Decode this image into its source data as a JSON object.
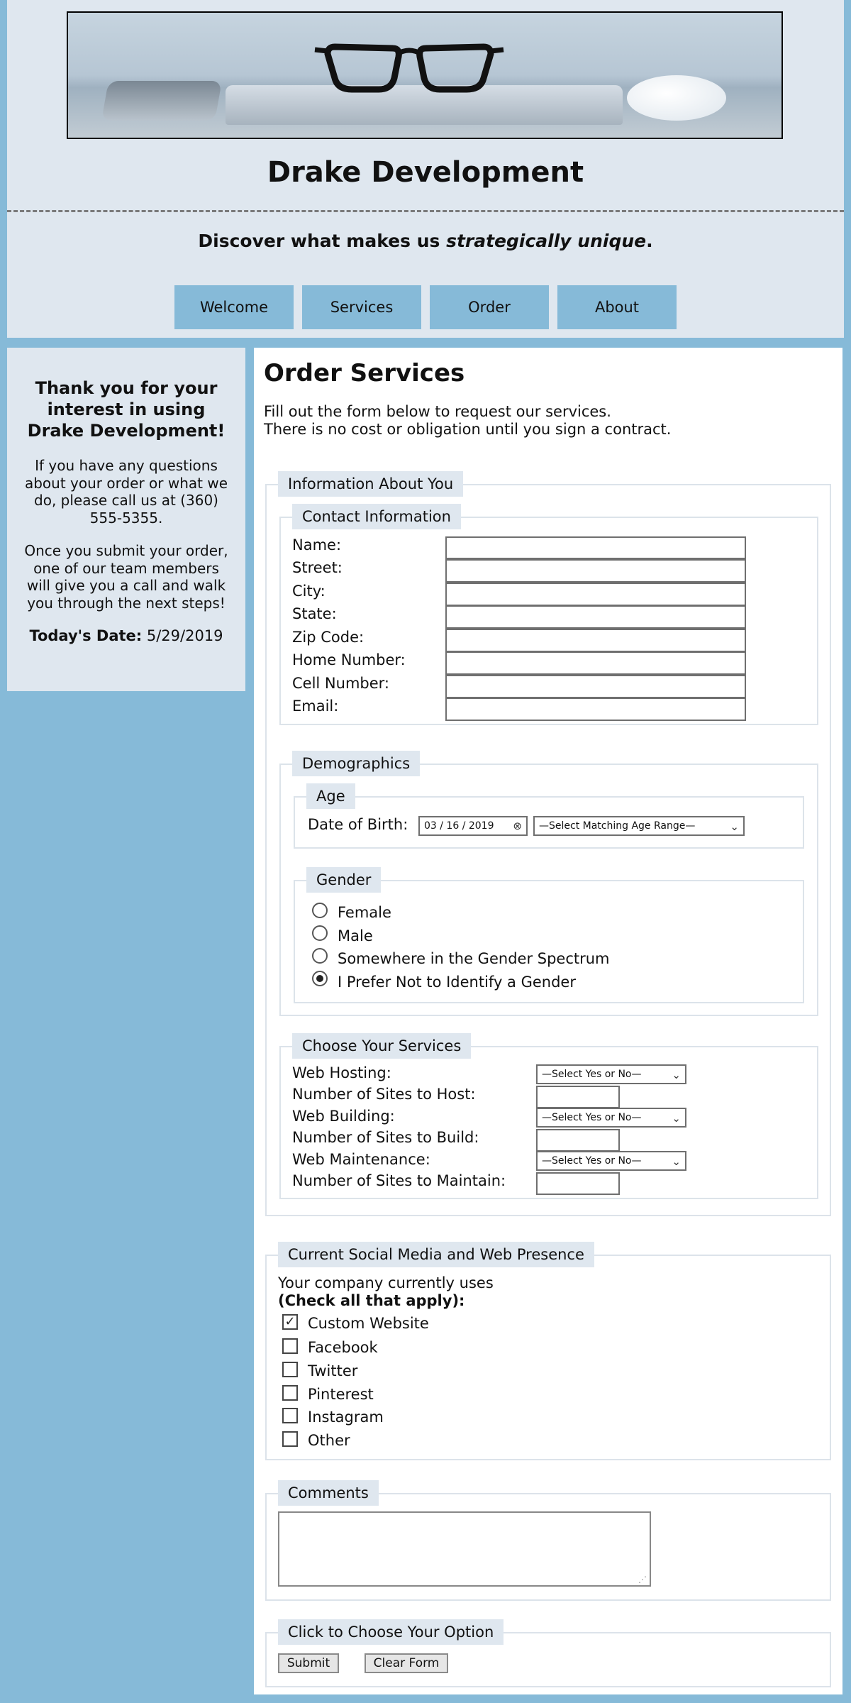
{
  "header": {
    "site_title": "Drake Development",
    "tagline_start": "Discover what makes us ",
    "tagline_em": "strategically unique",
    "tagline_end": ".",
    "nav": [
      "Welcome",
      "Services",
      "Order",
      "About"
    ]
  },
  "sidebar": {
    "thanks": "Thank you for your interest in using Drake Development!",
    "para1": "If you have any questions about your order or what we do, please call us at (360) 555-5355.",
    "para2": "Once you submit your order, one of our team members will give you a call and walk you through the next steps!",
    "date_label": "Today's Date:",
    "date_value": "5/29/2019"
  },
  "main": {
    "heading": "Order Services",
    "intro_line1": "Fill out the form below to request our services.",
    "intro_line2": "There is no cost or obligation until you sign a contract."
  },
  "about_you": {
    "legend": "Information About You",
    "contact": {
      "legend": "Contact Information",
      "fields": [
        "Name:",
        "Street:",
        "City:",
        "State:",
        "Zip Code:",
        "Home Number:",
        "Cell Number:",
        "Email:"
      ]
    },
    "demographics": {
      "legend": "Demographics",
      "age": {
        "legend": "Age",
        "dob_label": "Date of Birth:",
        "dob_value": "03 / 16 / 2019",
        "range_value": "—Select Matching Age Range—"
      },
      "gender": {
        "legend": "Gender",
        "options": [
          "Female",
          "Male",
          "Somewhere in the Gender Spectrum",
          "I Prefer Not to Identify a Gender"
        ],
        "selected_index": 3
      }
    },
    "services": {
      "legend": "Choose Your Services",
      "rows": [
        {
          "label": "Web Hosting:",
          "select": "—Select Yes or No—",
          "count_label": "Number of Sites to Host:"
        },
        {
          "label": "Web Building:",
          "select": "—Select Yes or No—",
          "count_label": "Number of Sites to Build:"
        },
        {
          "label": "Web Maintenance:",
          "select": "—Select Yes or No—",
          "count_label": "Number of Sites to Maintain:"
        }
      ]
    }
  },
  "social": {
    "legend": "Current Social Media and Web Presence",
    "intro": "Your company currently uses",
    "hint": "(Check all that apply):",
    "options": [
      {
        "label": "Custom Website",
        "checked": true
      },
      {
        "label": "Facebook",
        "checked": false
      },
      {
        "label": "Twitter",
        "checked": false
      },
      {
        "label": "Pinterest",
        "checked": false
      },
      {
        "label": "Instagram",
        "checked": false
      },
      {
        "label": "Other",
        "checked": false
      }
    ]
  },
  "comments": {
    "legend": "Comments",
    "value": ""
  },
  "actions": {
    "legend": "Click to Choose Your Option",
    "submit": "Submit",
    "clear": "Clear Form"
  },
  "colors": {
    "background": "#86bad8",
    "panel": "#dfe7ef",
    "nav_button": "#86bad8"
  },
  "icons": {
    "radio_selected": "radio-on",
    "checkbox_checked": "check-mark",
    "date_clear": "clear-icon",
    "select": "chevron-down-icon"
  }
}
